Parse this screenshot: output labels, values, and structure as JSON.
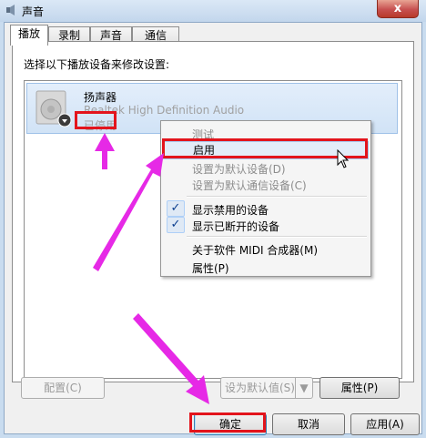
{
  "window": {
    "title": "声音",
    "close_label": "x"
  },
  "tabs": [
    {
      "label": "播放"
    },
    {
      "label": "录制"
    },
    {
      "label": "声音"
    },
    {
      "label": "通信"
    }
  ],
  "instruction": "选择以下播放设备来修改设置:",
  "device": {
    "name": "扬声器",
    "driver": "Realtek High Definition Audio",
    "status": "已停用"
  },
  "context_menu": {
    "items": [
      {
        "label": "测试",
        "enabled": false
      },
      {
        "label": "启用",
        "enabled": true,
        "highlighted": true
      },
      {
        "label": "设置为默认设备(D)",
        "enabled": false
      },
      {
        "label": "设置为默认通信设备(C)",
        "enabled": false
      },
      {
        "label": "显示禁用的设备",
        "checked": true
      },
      {
        "label": "显示已断开的设备",
        "checked": true
      },
      {
        "label": "关于软件 MIDI 合成器(M)",
        "enabled": true
      },
      {
        "label": "属性(P)",
        "enabled": true
      }
    ]
  },
  "panel_buttons": {
    "configure": "配置(C)",
    "set_default": "设为默认值(S)",
    "properties": "属性(P)"
  },
  "dialog_buttons": {
    "ok": "确定",
    "cancel": "取消",
    "apply": "应用(A)"
  },
  "colors": {
    "annotation_red": "#e3141c",
    "annotation_arrow": "#e629e6"
  }
}
